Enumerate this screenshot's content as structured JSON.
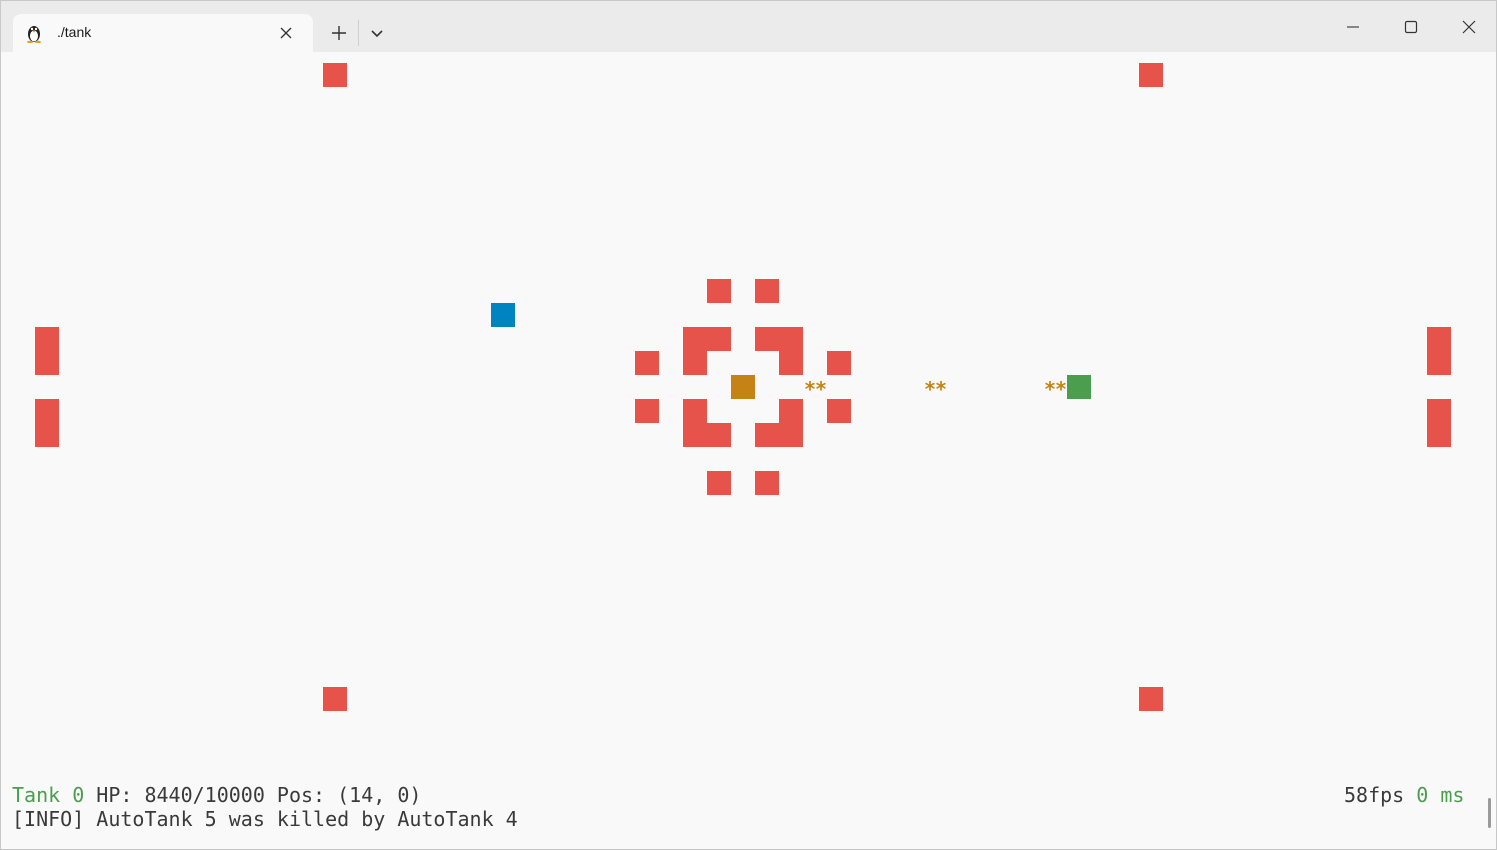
{
  "window": {
    "tab_title": "./tank",
    "tab_icon": "linux-penguin-icon"
  },
  "colors": {
    "wall": "#e5534b",
    "player": "#c48314",
    "enemy_blue": "#0083c1",
    "enemy_green": "#4c9e4f",
    "bullet": "#c48314",
    "text": "#3a3a3a",
    "highlight": "#4c9e4f",
    "background": "#f9f9f9"
  },
  "game": {
    "bullets": [
      "**",
      "**",
      "**"
    ]
  },
  "status": {
    "tank_label": "Tank 0",
    "hp_text": "HP: 8440/10000",
    "pos_text": "Pos: (14, 0)",
    "fps_text": "58fps",
    "latency_value": "0 ms",
    "log_message": "[INFO] AutoTank 5 was killed by AutoTank 4"
  }
}
